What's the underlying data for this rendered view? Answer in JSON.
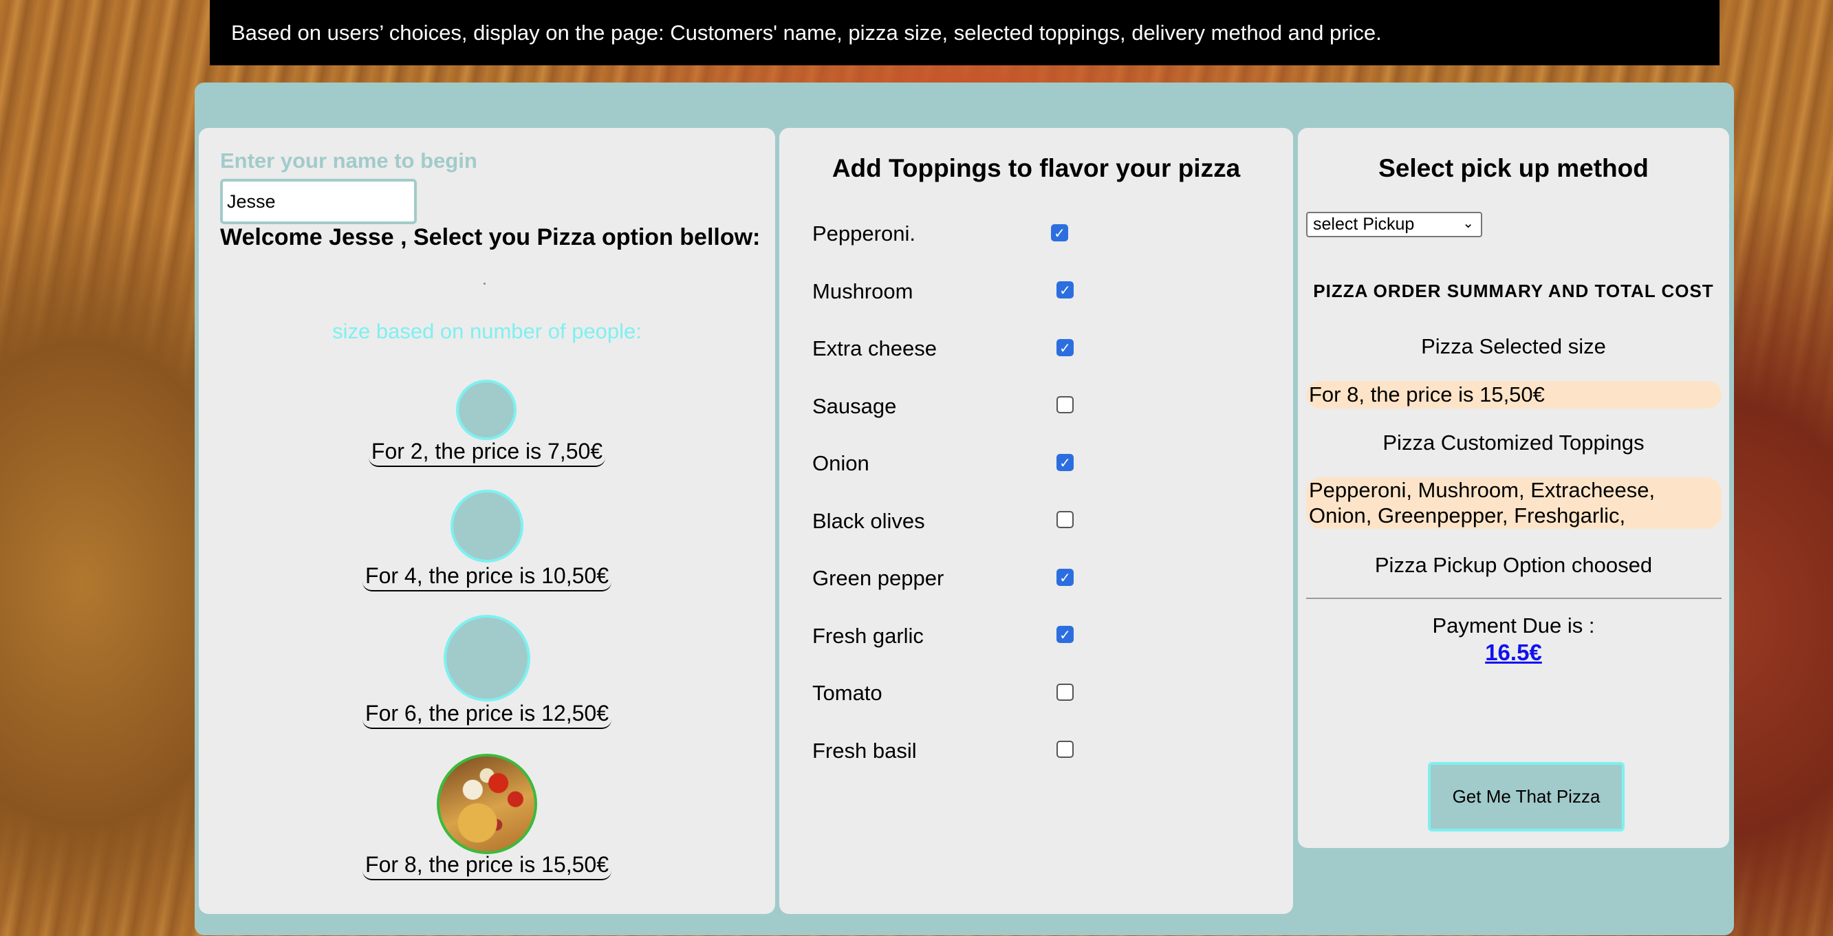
{
  "banner": {
    "text": "Based on users’ choices, display on the page: Customers' name, pizza size, selected toppings, delivery method and price."
  },
  "name_panel": {
    "prompt": "Enter your name to begin",
    "name_value": "Jesse",
    "welcome": "Welcome Jesse , Select you Pizza option bellow:",
    "size_title": "size based on number of people:",
    "sizes": [
      {
        "label": "For 2, the price is 7,50€"
      },
      {
        "label": "For 4, the price is 10,50€"
      },
      {
        "label": "For 6, the price is 12,50€"
      },
      {
        "label": "For 8, the price is 15,50€",
        "selected": true
      }
    ]
  },
  "toppings_panel": {
    "title": "Add Toppings to flavor your pizza",
    "toppings": [
      {
        "label": "Pepperoni.",
        "checked": true
      },
      {
        "label": "Mushroom",
        "checked": true
      },
      {
        "label": "Extra cheese",
        "checked": true
      },
      {
        "label": "Sausage",
        "checked": false
      },
      {
        "label": "Onion",
        "checked": true
      },
      {
        "label": "Black olives",
        "checked": false
      },
      {
        "label": "Green pepper",
        "checked": true
      },
      {
        "label": "Fresh garlic",
        "checked": true
      },
      {
        "label": "Tomato",
        "checked": false
      },
      {
        "label": "Fresh basil",
        "checked": false
      }
    ]
  },
  "pickup_panel": {
    "title": "Select pick up method",
    "select_value": "select Pickup",
    "summary_title": "PIZZA ORDER SUMMARY AND TOTAL COST",
    "size_label": "Pizza Selected size",
    "size_value": "For 8, the price is 15,50€",
    "toppings_label": "Pizza Customized Toppings",
    "toppings_value": "Pepperoni, Mushroom, Extracheese, Onion, Greenpepper, Freshgarlic,",
    "pickup_label": "Pizza Pickup Option choosed",
    "payment_label": "Payment Due is :",
    "payment_value": "16.5€",
    "button_label": "Get Me That Pizza"
  },
  "colors": {
    "accent_teal": "#a1cbca",
    "accent_cyan": "#7ff0f0",
    "highlight_peach": "#fde4c8",
    "link_blue": "#1111ee",
    "checkbox_blue": "#2c6ee0"
  }
}
